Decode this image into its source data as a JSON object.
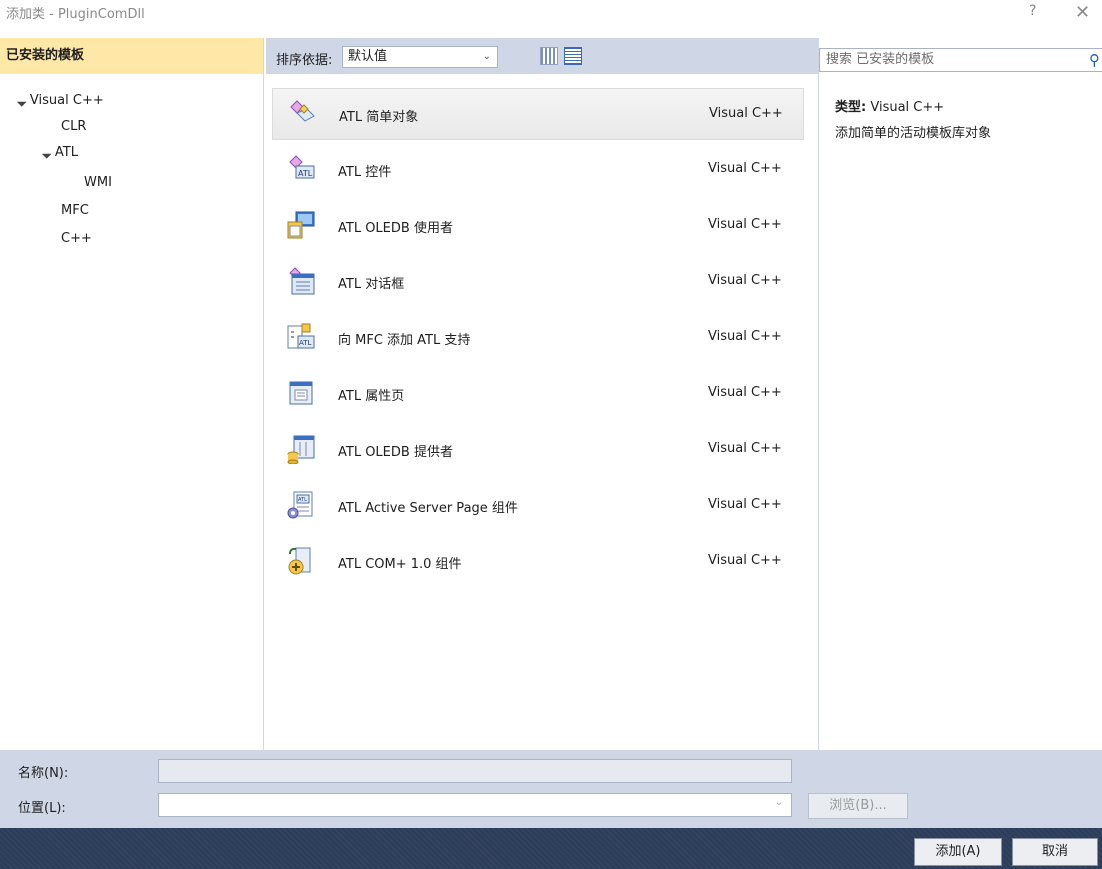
{
  "window": {
    "title": "添加类 - PluginComDll",
    "help_glyph": "?",
    "close_glyph": "✕"
  },
  "left": {
    "header": "已安装的模板",
    "tree": [
      {
        "label": "Visual C++",
        "expanded": true
      },
      {
        "label": "CLR"
      },
      {
        "label": "ATL",
        "expanded": true
      },
      {
        "label": "WMI"
      },
      {
        "label": "MFC"
      },
      {
        "label": "C++"
      }
    ]
  },
  "toolbar": {
    "sort_label": "排序依据:",
    "sort_value": "默认值"
  },
  "templates": [
    {
      "name": "ATL 简单对象",
      "lang": "Visual C++",
      "selected": true,
      "icon": "atl-simple-object-icon"
    },
    {
      "name": "ATL 控件",
      "lang": "Visual C++",
      "icon": "atl-control-icon"
    },
    {
      "name": "ATL OLEDB 使用者",
      "lang": "Visual C++",
      "icon": "oledb-consumer-icon"
    },
    {
      "name": "ATL 对话框",
      "lang": "Visual C++",
      "icon": "atl-dialog-icon"
    },
    {
      "name": "向 MFC 添加 ATL 支持",
      "lang": "Visual C++",
      "icon": "mfc-atl-support-icon"
    },
    {
      "name": "ATL 属性页",
      "lang": "Visual C++",
      "icon": "property-page-icon"
    },
    {
      "name": "ATL OLEDB 提供者",
      "lang": "Visual C++",
      "icon": "oledb-provider-icon"
    },
    {
      "name": "ATL Active Server Page 组件",
      "lang": "Visual C++",
      "icon": "asp-component-icon"
    },
    {
      "name": "ATL COM+ 1.0 组件",
      "lang": "Visual C++",
      "icon": "com-plus-component-icon"
    }
  ],
  "right": {
    "search_placeholder": "搜索 已安装的模板",
    "type_label": "类型:",
    "type_value": "Visual C++",
    "description": "添加简单的活动模板库对象"
  },
  "bottom": {
    "name_label": "名称(N):",
    "name_value": "",
    "location_label": "位置(L):",
    "location_value": "",
    "browse_label": "浏览(B)..."
  },
  "footer": {
    "add_label": "添加(A)",
    "cancel_label": "取消"
  }
}
